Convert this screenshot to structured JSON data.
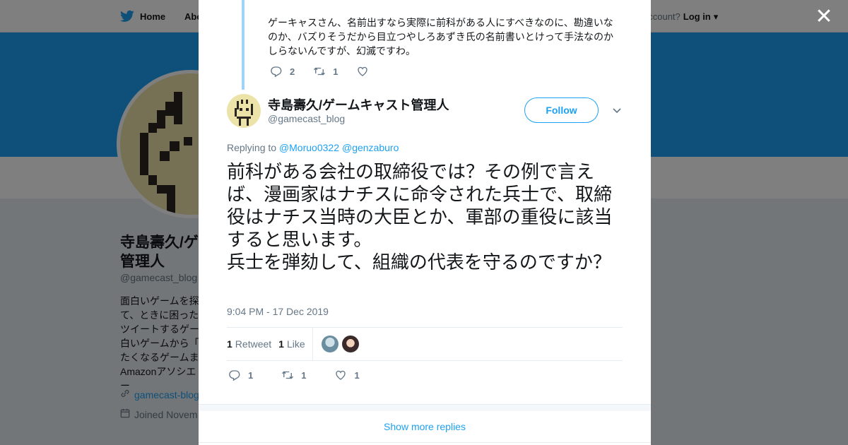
{
  "background": {
    "nav": {
      "home": "Home",
      "about": "Abo",
      "have_account": "account?",
      "login": "Log in"
    },
    "profile": {
      "name": "寺島壽久/ゲ 管理人",
      "handle": "@gamecast_blog",
      "bio": "面白いゲームを探 て、ときに困った ツイートするゲー 白いゲームから「 たくなるゲームま Amazonアソシエー",
      "link": "gamecast-blog",
      "joined": "Joined Novem"
    },
    "colors": {
      "banner": "#1da1f2"
    }
  },
  "modal": {
    "parent_tweet": {
      "text": "ゲーキャスさん、名前出すなら実際に前科がある人にすべきなのに、勘違いなのか、バズりそうだから目立つやしろあずき氏の名前書いとけって手法なのかしらないんですが、幻滅ですわ。",
      "replies": "2",
      "retweets": "1"
    },
    "tweet": {
      "author_name": "寺島壽久/ゲームキャスト管理人",
      "author_handle": "@gamecast_blog",
      "follow_label": "Follow",
      "replying_to_label": "Replying to",
      "replying_to": [
        "@Moruo0322",
        "@genzaburo"
      ],
      "text": "前科がある会社の取締役では？その例で言えば、漫画家はナチスに命令された兵士で、取締役はナチス当時の大臣とか、軍部の重役に該当すると思います。\n兵士を弾劾して、組織の代表を守るのですか？",
      "timestamp": "9:04 PM - 17 Dec 2019",
      "retweet_count": "1",
      "retweet_label": "Retweet",
      "like_count": "1",
      "like_label": "Like",
      "action_replies": "1",
      "action_retweets": "1",
      "action_likes": "1"
    },
    "show_more": "Show more replies"
  },
  "icons": [
    "twitter-bird-icon",
    "close-icon",
    "reply-icon",
    "retweet-icon",
    "heart-icon",
    "chevron-down-icon",
    "link-icon",
    "calendar-icon"
  ],
  "accent_color": "#1da1f2"
}
